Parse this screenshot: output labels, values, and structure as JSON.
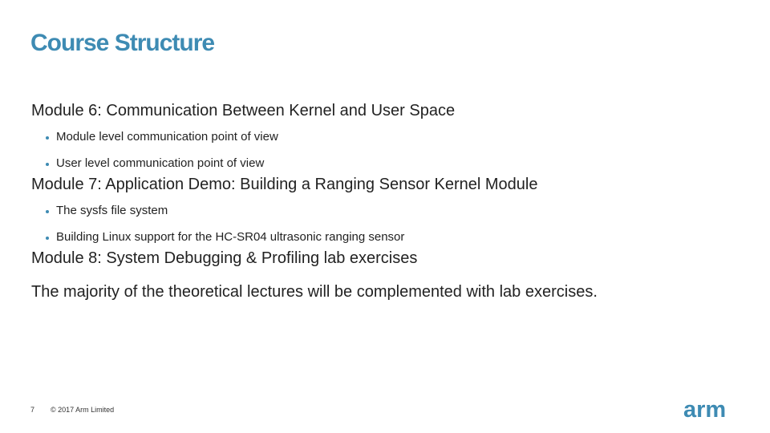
{
  "slide": {
    "title": "Course Structure",
    "modules": [
      {
        "heading": "Module 6: Communication Between Kernel and User Space",
        "bullets": [
          "Module level communication point of view",
          "User level communication point of view"
        ]
      },
      {
        "heading": "Module 7: Application Demo: Building a Ranging Sensor Kernel Module",
        "bullets": [
          "The sysfs file system",
          "Building Linux support for the HC-SR04 ultrasonic ranging sensor"
        ]
      },
      {
        "heading": "Module 8: System Debugging & Profiling lab exercises",
        "bullets": []
      }
    ],
    "closing": "The majority of the theoretical lectures will be complemented with lab exercises."
  },
  "footer": {
    "page_number": "7",
    "copyright": "© 2017 Arm Limited",
    "logo": "arm"
  },
  "colors": {
    "accent": "#3e8bb3",
    "text": "#222222"
  }
}
